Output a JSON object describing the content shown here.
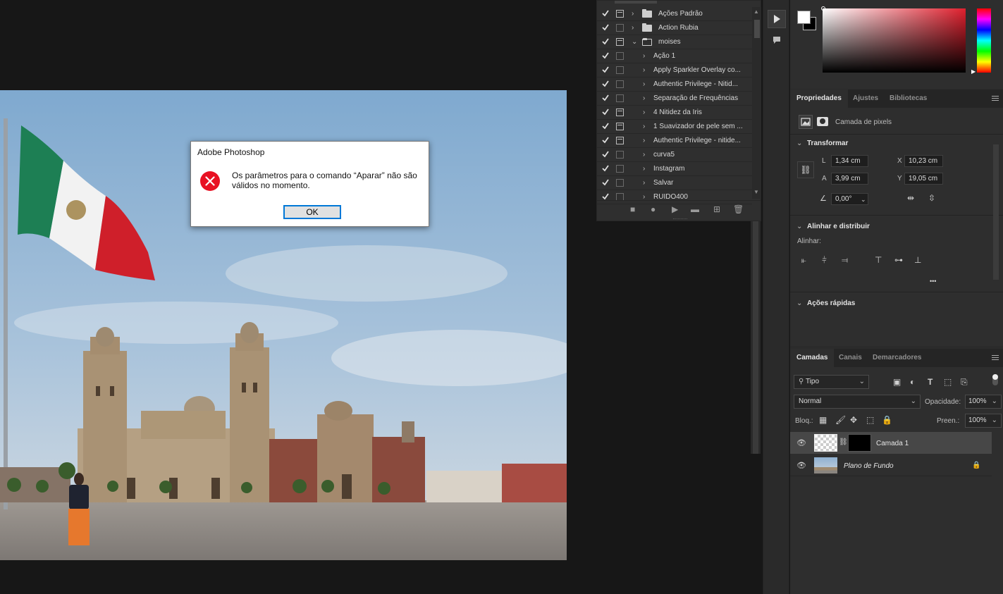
{
  "dialog": {
    "title": "Adobe Photoshop",
    "message": "Os parâmetros para o comando “Aparar” não são válidos no momento.",
    "ok_label": "OK"
  },
  "actions_panel": {
    "items": [
      {
        "label": "Ações Padrão",
        "type": "set",
        "checked": true,
        "dialog": true,
        "expanded": false
      },
      {
        "label": "Action Rubia",
        "type": "set",
        "checked": true,
        "dialog": false,
        "expanded": false
      },
      {
        "label": "moises",
        "type": "set",
        "checked": true,
        "dialog": true,
        "expanded": true
      },
      {
        "label": "Ação 1",
        "type": "action",
        "checked": true,
        "dialog": false
      },
      {
        "label": "Apply Sparkler Overlay co...",
        "type": "action",
        "checked": true,
        "dialog": false
      },
      {
        "label": "Authentic Privilege - Nitid...",
        "type": "action",
        "checked": true,
        "dialog": false
      },
      {
        "label": "Separação de Frequências",
        "type": "action",
        "checked": true,
        "dialog": false
      },
      {
        "label": "4 Nitidez da Iris",
        "type": "action",
        "checked": true,
        "dialog": true
      },
      {
        "label": "1 Suavizador de pele sem ...",
        "type": "action",
        "checked": true,
        "dialog": true
      },
      {
        "label": "Authentic Privilege - nitide...",
        "type": "action",
        "checked": true,
        "dialog": true
      },
      {
        "label": "curva5",
        "type": "action",
        "checked": true,
        "dialog": false
      },
      {
        "label": "Instagram",
        "type": "action",
        "checked": true,
        "dialog": false
      },
      {
        "label": "Salvar",
        "type": "action",
        "checked": true,
        "dialog": false
      },
      {
        "label": "RUIDO400",
        "type": "action",
        "checked": true,
        "dialog": false
      }
    ]
  },
  "properties": {
    "tabs": [
      "Propriedades",
      "Ajustes",
      "Bibliotecas"
    ],
    "layer_kind": "Camada de pixels",
    "transform_heading": "Transformar",
    "w_label": "L",
    "w_value": "1,34 cm",
    "h_label": "A",
    "h_value": "3,99 cm",
    "x_label": "X",
    "x_value": "10,23 cm",
    "y_label": "Y",
    "y_value": "19,05 cm",
    "angle_value": "0,00°",
    "align_heading": "Alinhar e distribuir",
    "align_label": "Alinhar:",
    "quick_heading": "Ações rápidas",
    "more": "•••"
  },
  "layers": {
    "tabs": [
      "Camadas",
      "Canais",
      "Demarcadores"
    ],
    "filter_kind": "Tipo",
    "blend_mode": "Normal",
    "opacity_label": "Opacidade:",
    "opacity_value": "100%",
    "lock_label": "Bloq.:",
    "fill_label": "Preen.:",
    "fill_value": "100%",
    "rows": [
      {
        "name": "Camada 1",
        "selected": true
      },
      {
        "name": "Plano de Fundo",
        "selected": false
      }
    ]
  },
  "colors": {
    "accent": "#0078d7",
    "error": "#e81123"
  }
}
